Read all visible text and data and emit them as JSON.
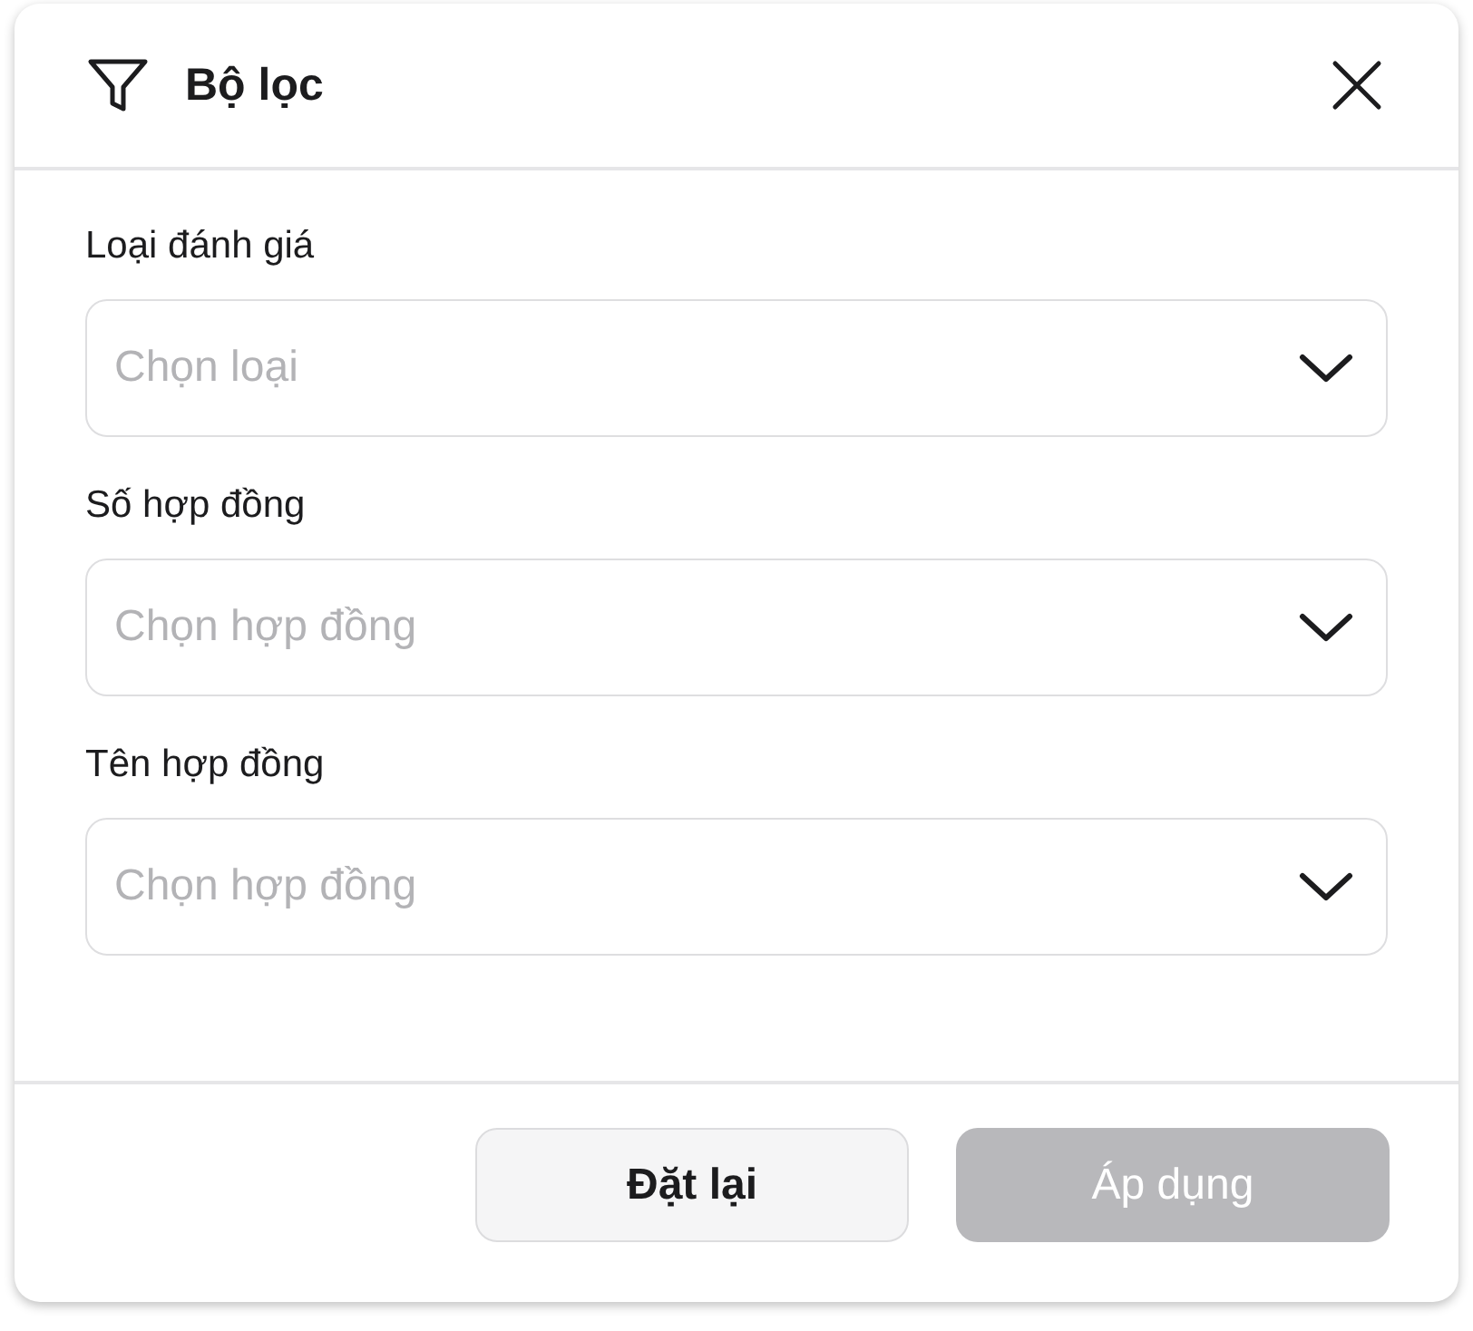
{
  "dialog": {
    "title": "Bộ lọc"
  },
  "fields": [
    {
      "label": "Loại đánh giá",
      "placeholder": "Chọn loại"
    },
    {
      "label": "Số hợp đồng",
      "placeholder": "Chọn hợp đồng"
    },
    {
      "label": "Tên hợp đồng",
      "placeholder": "Chọn hợp đồng"
    }
  ],
  "buttons": [
    {
      "label": "Đặt lại",
      "kind": "secondary",
      "disabled": false
    },
    {
      "label": "Áp dụng",
      "kind": "primary",
      "disabled": true
    }
  ]
}
